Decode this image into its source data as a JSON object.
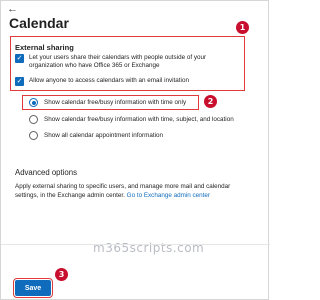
{
  "header": {
    "back_glyph": "←",
    "title": "Calendar"
  },
  "callouts": [
    "1",
    "2",
    "3"
  ],
  "external_sharing": {
    "label": "External sharing",
    "checkboxes": [
      {
        "label": "Let your users share their calendars with people outside of your organization who have Office 365 or Exchange",
        "checked": true
      },
      {
        "label": "Allow anyone to access calendars with an email invitation",
        "checked": true
      }
    ]
  },
  "sharing_options": [
    {
      "label": "Show calendar free/busy information with time only",
      "selected": true
    },
    {
      "label": "Show calendar free/busy information with time, subject, and location",
      "selected": false
    },
    {
      "label": "Show all calendar appointment information",
      "selected": false
    }
  ],
  "advanced": {
    "title": "Advanced options",
    "text": "Apply external sharing to specific users, and manage more mail and calendar settings, in the Exchange admin center.",
    "link": "Go to Exchange admin center"
  },
  "watermark": "m365scripts.com",
  "footer": {
    "save_label": "Save"
  },
  "colors": {
    "accent": "#0f6cbd",
    "highlight": "#e03a3a",
    "callout": "#c8102e"
  }
}
